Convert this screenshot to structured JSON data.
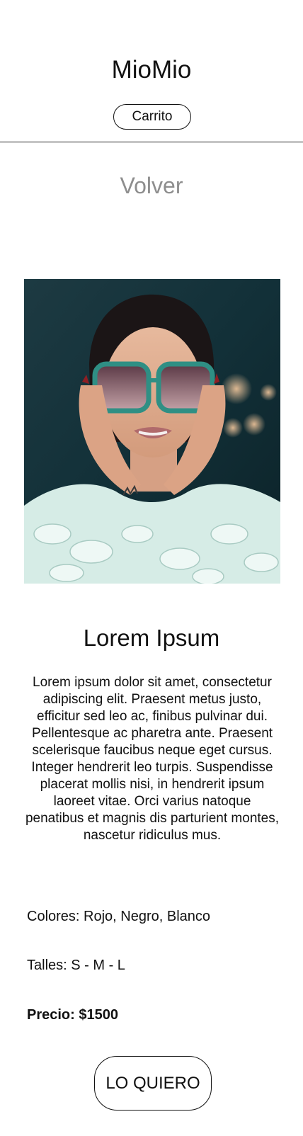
{
  "header": {
    "brand": "MioMio",
    "cart_label": "Carrito"
  },
  "nav": {
    "back_label": "Volver"
  },
  "product": {
    "image_icon": "product-photo",
    "title": "Lorem Ipsum",
    "description": "Lorem ipsum dolor sit amet, consectetur adipiscing elit. Praesent metus justo, efficitur sed leo ac, finibus pulvinar dui. Pellentesque ac pharetra ante. Praesent scelerisque faucibus neque eget cursus. Integer hendrerit leo turpis. Suspendisse placerat mollis nisi, in hendrerit ipsum laoreet vitae. Orci varius natoque penatibus et magnis dis parturient montes, nascetur ridiculus mus.",
    "colors": "Colores: Rojo, Negro, Blanco",
    "sizes": "Talles: S - M - L",
    "price": "Precio: $1500",
    "buy_label": "LO QUIERO"
  },
  "colors": {
    "text": "#111111",
    "muted": "#8e8e8e",
    "background": "#ffffff"
  }
}
